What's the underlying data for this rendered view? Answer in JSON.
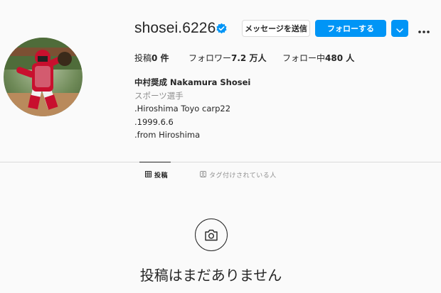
{
  "profile": {
    "username": "shosei.6226",
    "message_button": "メッセージを送信",
    "follow_button": "フォローする",
    "stats": {
      "posts_label": "投稿",
      "posts_value": "0 件",
      "followers_label": "フォロワー",
      "followers_value": "7.2 万人",
      "following_label": "フォロー中",
      "following_value": "480 人"
    },
    "bio": {
      "name": "中村奨成 Nakamura Shosei",
      "category": "スポーツ選手",
      "lines": [
        ".Hiroshima Toyo carp22",
        ".1999.6.6",
        ".from Hiroshima"
      ]
    }
  },
  "tabs": {
    "posts": "投稿",
    "tagged": "タグ付けされている人"
  },
  "empty_state": {
    "message": "投稿はまだありません"
  },
  "icons": {
    "verified": "verified-badge-icon",
    "dropdown": "chevron-down-icon",
    "more": "more-options-icon",
    "grid": "grid-icon",
    "tagged": "tagged-person-icon",
    "camera": "camera-icon"
  },
  "colors": {
    "accent": "#0095f6",
    "text": "#262626",
    "muted": "#8e8e8e",
    "border": "#dbdbdb",
    "background": "#fafafa"
  }
}
